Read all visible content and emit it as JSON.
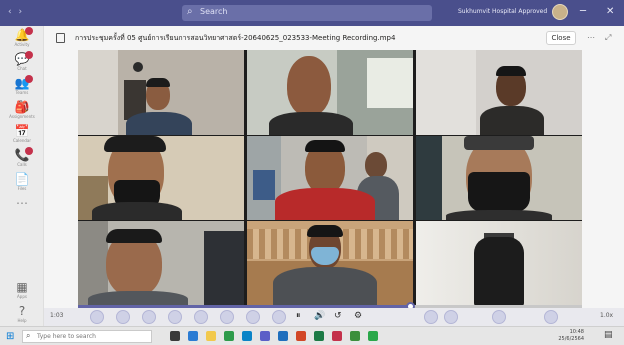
{
  "window": {
    "search_placeholder": "Search",
    "account_text": "Sukhumvit Hospital Approved",
    "minimize": "─",
    "close": "✕"
  },
  "rail": [
    {
      "icon": "activity-icon",
      "glyph": "🔔",
      "label": "Activity",
      "badge": true
    },
    {
      "icon": "chat-icon",
      "glyph": "💬",
      "label": "Chat",
      "badge": true
    },
    {
      "icon": "teams-icon",
      "glyph": "👥",
      "label": "Teams",
      "badge": true
    },
    {
      "icon": "assignments-icon",
      "glyph": "🎒",
      "label": "Assignments",
      "badge": false
    },
    {
      "icon": "calendar-icon",
      "glyph": "📅",
      "label": "Calendar",
      "badge": false
    },
    {
      "icon": "calls-icon",
      "glyph": "📞",
      "label": "Calls",
      "badge": true
    },
    {
      "icon": "files-icon",
      "glyph": "📄",
      "label": "Files",
      "badge": false
    },
    {
      "icon": "more-icon",
      "glyph": "⋯",
      "label": "",
      "badge": false
    },
    {
      "icon": "apps-icon",
      "glyph": "▦",
      "label": "Apps",
      "badge": false
    },
    {
      "icon": "help-icon",
      "glyph": "?",
      "label": "Help",
      "badge": false
    }
  ],
  "header": {
    "title": "การประชุมครั้งที่ 05 ศูนย์การเรียนการสอนวิทยาศาสตร์-20640625_023533-Meeting Recording.mp4",
    "close_label": "Close"
  },
  "player": {
    "current_time": "1:03",
    "progress": 0.66,
    "speed": "1.0x"
  },
  "taskbar": {
    "search_placeholder": "Type here to search",
    "time": "10:48",
    "date": "25/6/2564"
  },
  "colors": {
    "accent": "#6264a7",
    "titlebar": "#4a4f8c",
    "badge": "#c4314b"
  }
}
